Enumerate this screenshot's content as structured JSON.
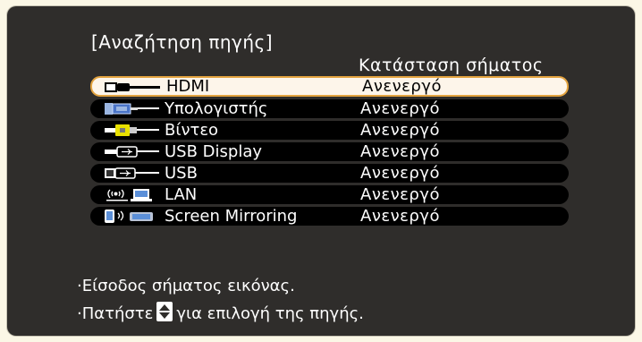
{
  "dialog": {
    "title": "[Αναζήτηση πηγής]",
    "status_column_header": "Κατάσταση σήματος"
  },
  "sources": [
    {
      "label": "HDMI",
      "status": "Ανενεργό",
      "icon": "hdmi-icon",
      "selected": true
    },
    {
      "label": "Υπολογιστής",
      "status": "Ανενεργό",
      "icon": "computer-icon",
      "selected": false
    },
    {
      "label": "Βίντεο",
      "status": "Ανενεργό",
      "icon": "video-icon",
      "selected": false
    },
    {
      "label": "USB Display",
      "status": "Ανενεργό",
      "icon": "usb-display-icon",
      "selected": false
    },
    {
      "label": "USB",
      "status": "Ανενεργό",
      "icon": "usb-icon",
      "selected": false
    },
    {
      "label": "LAN",
      "status": "Ανενεργό",
      "icon": "lan-icon",
      "selected": false
    },
    {
      "label": "Screen Mirroring",
      "status": "Ανενεργό",
      "icon": "screen-mirroring-icon",
      "selected": false
    }
  ],
  "hints": {
    "line1": "·Είσοδος σήματος εικόνας.",
    "line2_before": "·Πατήστε",
    "line2_after": "για επιλογή της πηγής.",
    "arrows_icon": "up-down-arrows-icon"
  },
  "colors": {
    "background": "#2f2d2b",
    "row": "#000000",
    "selected_row": "#fdf5ea",
    "selected_border": "#e3a33f"
  }
}
